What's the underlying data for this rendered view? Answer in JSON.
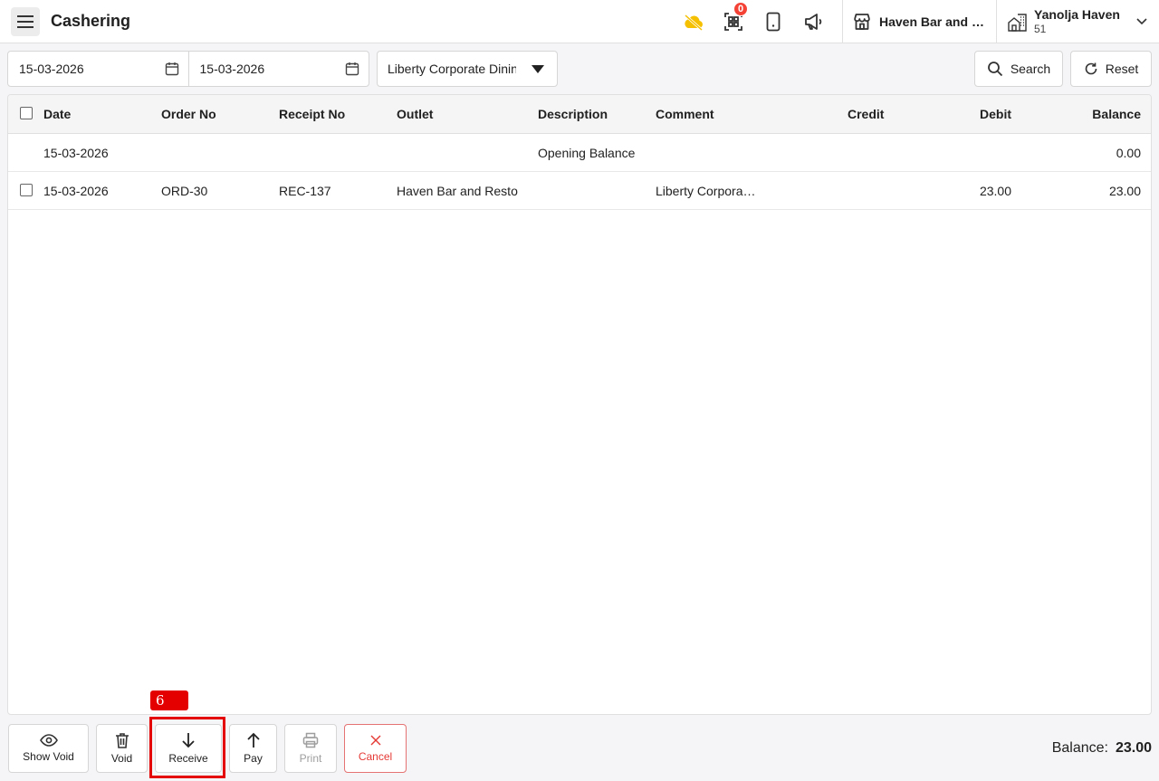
{
  "header": {
    "title": "Cashering",
    "notification_count": "0",
    "outlet_name": "Haven Bar and Resto",
    "property_name": "Yanolja Haven",
    "property_number": "51"
  },
  "filters": {
    "from_date": "15-03-2026",
    "to_date": "15-03-2026",
    "account": "Liberty Corporate Dining",
    "search_label": "Search",
    "reset_label": "Reset"
  },
  "table": {
    "columns": {
      "date": "Date",
      "order_no": "Order No",
      "receipt_no": "Receipt No",
      "outlet": "Outlet",
      "description": "Description",
      "comment": "Comment",
      "credit": "Credit",
      "debit": "Debit",
      "balance": "Balance"
    },
    "rows": [
      {
        "date": "15-03-2026",
        "order_no": "",
        "receipt_no": "",
        "outlet": "",
        "description": "Opening Balance",
        "comment": "",
        "credit": "",
        "debit": "",
        "balance": "0.00"
      },
      {
        "date": "15-03-2026",
        "order_no": "ORD-30",
        "receipt_no": "REC-137",
        "outlet": "Haven Bar and Resto",
        "description": "",
        "comment": "Liberty Corpora…",
        "credit": "",
        "debit": "23.00",
        "balance": "23.00"
      }
    ]
  },
  "actions": {
    "show_void": "Show Void",
    "void": "Void",
    "receive": "Receive",
    "pay": "Pay",
    "print": "Print",
    "cancel": "Cancel"
  },
  "annotation": {
    "step": "6"
  },
  "footer": {
    "balance_label": "Balance:",
    "balance_value": "23.00"
  },
  "colors": {
    "accent_red": "#e50000",
    "badge_red": "#f44336",
    "cloud_yellow": "#f5c000",
    "cancel_red": "#e53935"
  },
  "icons": [
    "menu-icon",
    "cloud-off-icon",
    "qr-scan-icon",
    "tablet-icon",
    "megaphone-icon",
    "store-icon",
    "building-icon",
    "chevron-down-icon",
    "calendar-icon",
    "search-icon",
    "refresh-icon",
    "eye-icon",
    "trash-icon",
    "arrow-down-icon",
    "arrow-up-icon",
    "printer-icon",
    "close-icon"
  ]
}
